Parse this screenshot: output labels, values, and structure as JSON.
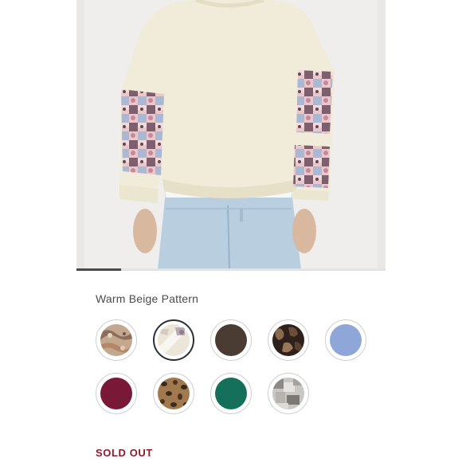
{
  "product": {
    "color_name": "Warm Beige Pattern",
    "status": "SOLD OUT"
  },
  "carousel": {
    "slide": 1
  },
  "swatches": [
    {
      "name": "patchwork-paisley",
      "color": "#b89a80",
      "selected": false
    },
    {
      "name": "warm-beige-pattern",
      "color": "#e8e2d4",
      "selected": true
    },
    {
      "name": "dark-brown",
      "color": "#4a3c33",
      "selected": false
    },
    {
      "name": "brown-camo",
      "color": "#3a2a22",
      "selected": false
    },
    {
      "name": "light-blue",
      "color": "#8fa6d8",
      "selected": false
    },
    {
      "name": "burgundy",
      "color": "#7a1838",
      "selected": false
    },
    {
      "name": "leopard",
      "color": "#8a6440",
      "selected": false
    },
    {
      "name": "green",
      "color": "#14705a",
      "selected": false
    },
    {
      "name": "grey-patchwork",
      "color": "#a8a6a2",
      "selected": false
    }
  ],
  "colors": {
    "accent_sold_out": "#8b1a2b",
    "selected_ring": "#2a2f38"
  }
}
